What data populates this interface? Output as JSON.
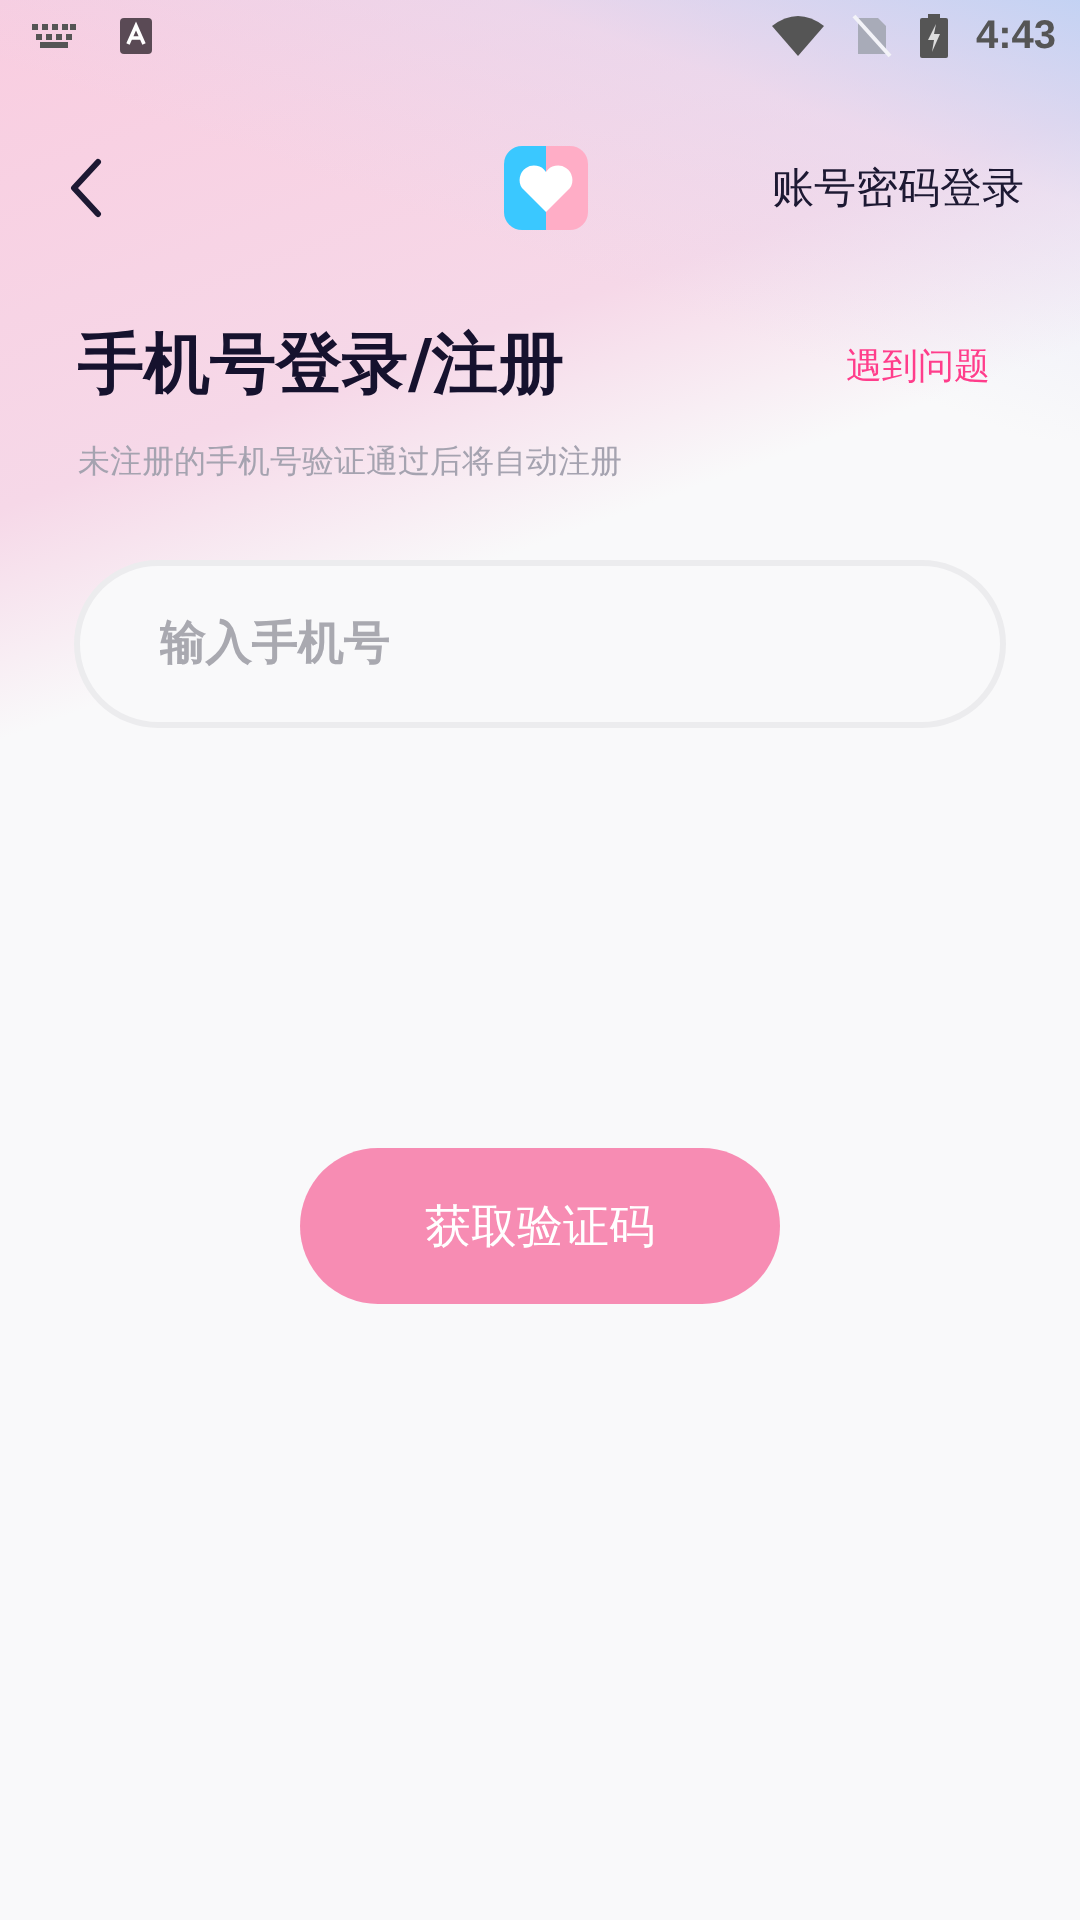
{
  "status_bar": {
    "time": "4:43"
  },
  "nav": {
    "action": "账号密码登录"
  },
  "header": {
    "title": "手机号登录/注册",
    "help": "遇到问题",
    "subtitle": "未注册的手机号验证通过后将自动注册"
  },
  "phone_field": {
    "placeholder": "输入手机号"
  },
  "submit": {
    "label": "获取验证码",
    "disabled": true
  }
}
